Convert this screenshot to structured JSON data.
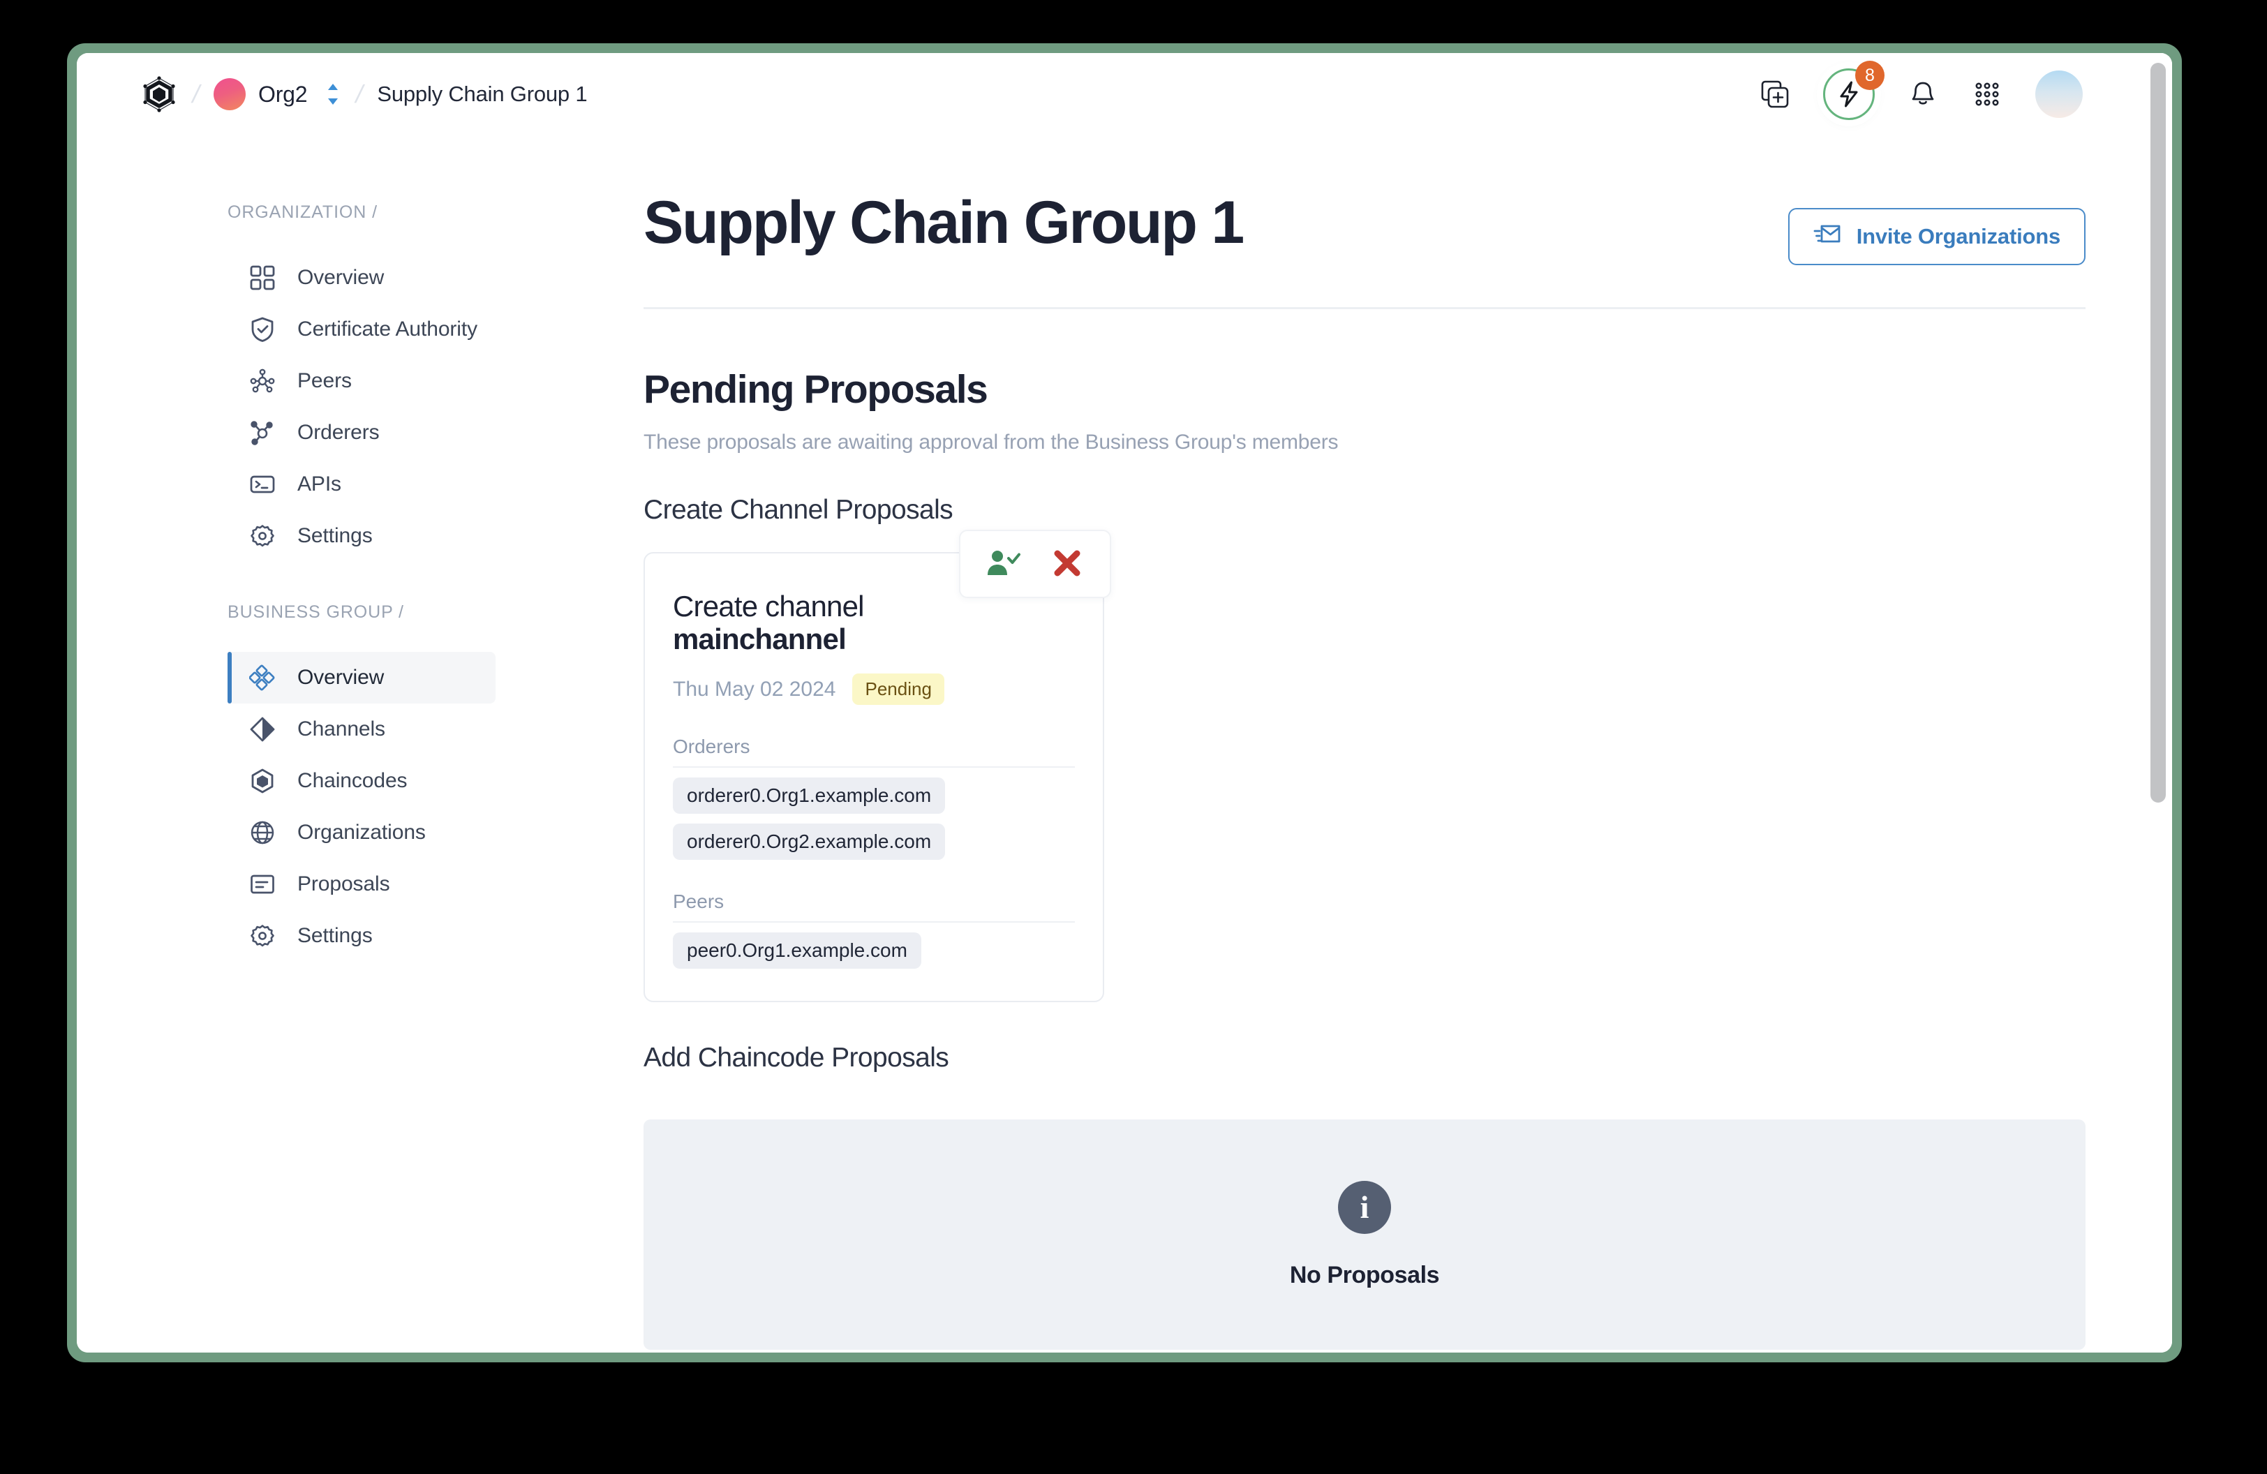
{
  "topbar": {
    "logo_icon": "blockchain-hexagon-logo",
    "org_name": "Org2",
    "org_switcher_icon": "chevron-up-down-icon",
    "group_name": "Supply Chain Group 1",
    "actions": [
      {
        "icon": "add-page-icon",
        "name": "add-page-button"
      },
      {
        "icon": "lightning-bolt-icon",
        "name": "quick-actions-button",
        "badge": "8"
      },
      {
        "icon": "bell-icon",
        "name": "notifications-button"
      },
      {
        "icon": "apps-grid-icon",
        "name": "apps-grid-button"
      }
    ],
    "avatar_icon": "user-avatar"
  },
  "sidebar": {
    "groups": [
      {
        "title": "ORGANIZATION /",
        "items": [
          {
            "label": "Overview",
            "icon": "grid-squares-icon",
            "active": false
          },
          {
            "label": "Certificate Authority",
            "icon": "shield-check-icon",
            "active": false
          },
          {
            "label": "Peers",
            "icon": "network-nodes-icon",
            "active": false
          },
          {
            "label": "Orderers",
            "icon": "hub-node-icon",
            "active": false
          },
          {
            "label": "APIs",
            "icon": "terminal-icon",
            "active": false
          },
          {
            "label": "Settings",
            "icon": "gear-icon",
            "active": false
          }
        ]
      },
      {
        "title": "BUSINESS GROUP /",
        "items": [
          {
            "label": "Overview",
            "icon": "diamond-cluster-icon",
            "active": true
          },
          {
            "label": "Channels",
            "icon": "diamond-split-icon",
            "active": false
          },
          {
            "label": "Chaincodes",
            "icon": "cube-hexagon-icon",
            "active": false
          },
          {
            "label": "Organizations",
            "icon": "globe-icon",
            "active": false
          },
          {
            "label": "Proposals",
            "icon": "document-lines-icon",
            "active": false
          },
          {
            "label": "Settings",
            "icon": "gear-icon",
            "active": false
          }
        ]
      }
    ]
  },
  "page": {
    "title": "Supply Chain Group 1",
    "invite_button": {
      "label": "Invite Organizations",
      "icon": "invite-envelope-icon"
    }
  },
  "pending": {
    "heading": "Pending Proposals",
    "subheading": "These proposals are awaiting approval from the Business Group's members",
    "create_channel_section": "Create Channel Proposals",
    "add_chaincode_section": "Add Chaincode Proposals"
  },
  "proposal_card": {
    "title_prefix": "Create channel",
    "title_strong": "mainchannel",
    "date": "Thu May 02 2024",
    "status": "Pending",
    "orderers_label": "Orderers",
    "orderers": [
      "orderer0.Org1.example.com",
      "orderer0.Org2.example.com"
    ],
    "peers_label": "Peers",
    "peers": [
      "peer0.Org1.example.com"
    ],
    "approve_icon": "person-check-icon",
    "reject_icon": "close-x-icon"
  },
  "empty_state": {
    "icon": "info-circle-icon",
    "text": "No Proposals"
  },
  "colors": {
    "frame_green": "#6f9b80",
    "accent_blue": "#3d7fc1",
    "badge_orange": "#e0672c",
    "ring_green": "#64b47d",
    "approve_green": "#3f8a5c",
    "reject_red": "#c33a32",
    "status_bg": "#fbf7c7",
    "status_text": "#6a5113"
  }
}
